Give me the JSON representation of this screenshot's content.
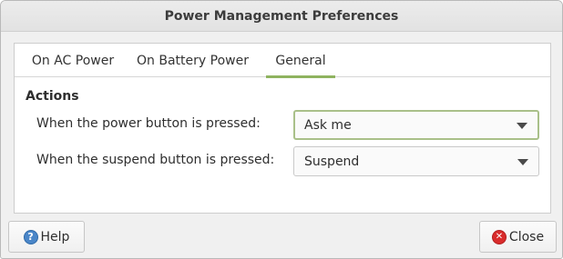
{
  "window": {
    "title": "Power Management Preferences"
  },
  "tabs": [
    {
      "label": "On AC Power",
      "active": false
    },
    {
      "label": "On Battery Power",
      "active": false
    },
    {
      "label": "General",
      "active": true
    }
  ],
  "actions": {
    "heading": "Actions",
    "power_button": {
      "label": "When the power button is pressed:",
      "value": "Ask me"
    },
    "suspend_button": {
      "label": "When the suspend button is pressed:",
      "value": "Suspend"
    }
  },
  "footer": {
    "help_label": "Help",
    "help_icon": "help-icon",
    "close_label": "Close",
    "close_icon": "close-icon"
  },
  "colors": {
    "accent": "#8fb35f",
    "focus_border": "#a9c089",
    "help_icon": "#4a86c8",
    "close_icon": "#d92b2b"
  }
}
